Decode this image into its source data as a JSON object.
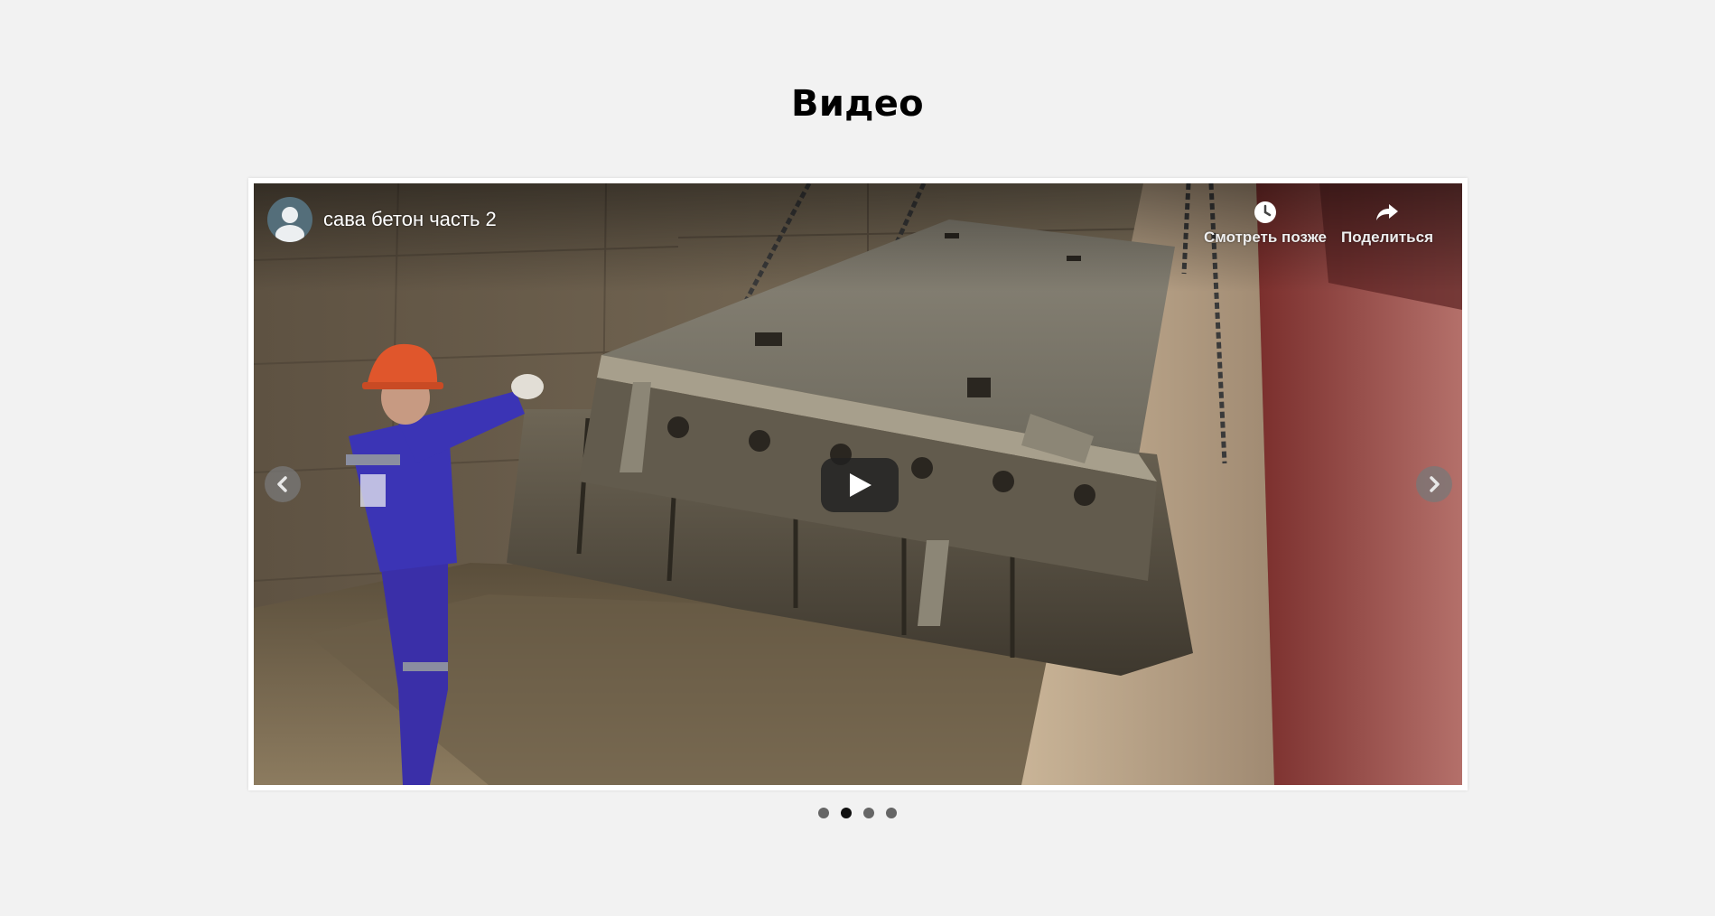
{
  "section": {
    "title": "Видео"
  },
  "video": {
    "title": "сава бетон часть 2",
    "watch_later_label": "Смотреть позже",
    "share_label": "Поделиться"
  },
  "carousel": {
    "slide_count": 4,
    "active_index": 1
  },
  "colors": {
    "page_background": "#f2f2f2",
    "avatar_background": "#546e7a",
    "dot_inactive": "#666666",
    "dot_active": "#111111"
  },
  "icons": {
    "avatar": "user-avatar-icon",
    "watch_later": "clock-icon",
    "share": "share-arrow-icon",
    "play": "play-icon",
    "prev": "chevron-left-icon",
    "next": "chevron-right-icon"
  }
}
